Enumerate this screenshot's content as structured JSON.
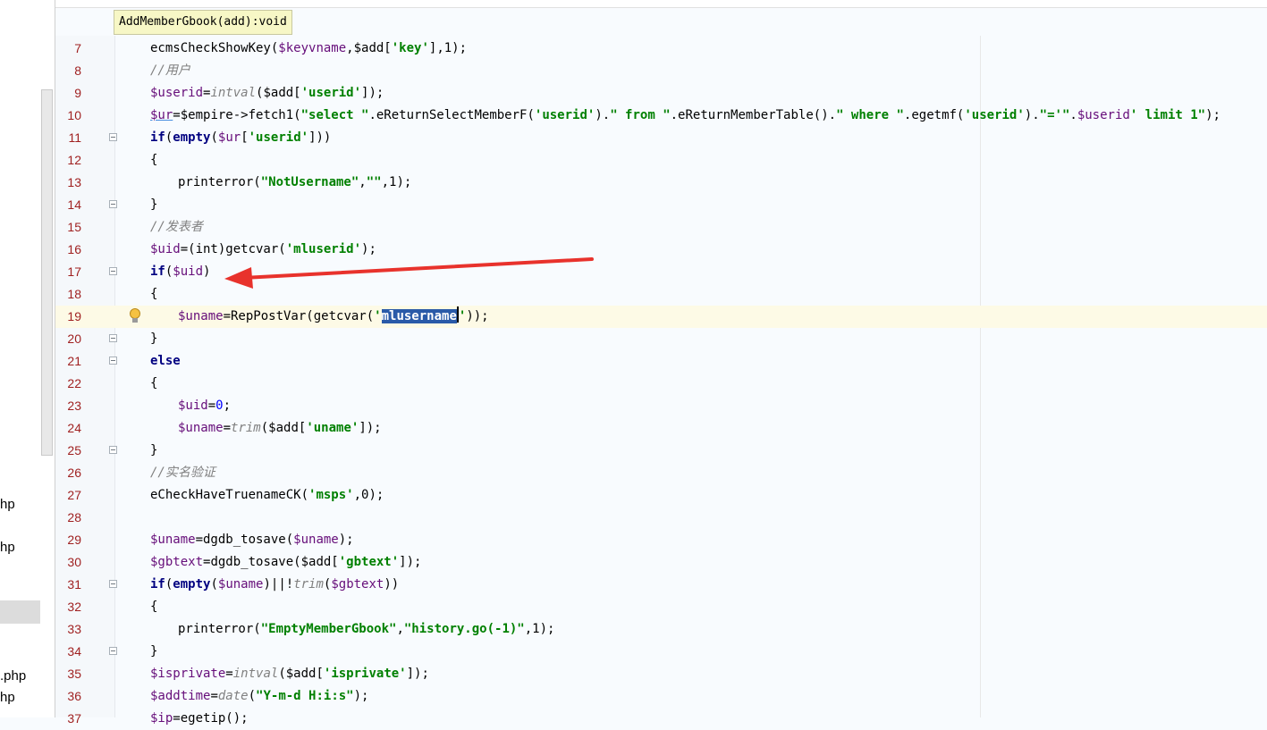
{
  "tooltip": "AddMemberGbook(add):void",
  "left_panel": {
    "files": [
      "hp",
      "hp",
      ".php",
      "hp"
    ]
  },
  "editor": {
    "current_line": 19,
    "lines": [
      {
        "n": "7",
        "fold": false,
        "indent": 1,
        "tokens": [
          [
            "fn",
            "ecmsCheckShowKey("
          ],
          [
            "var",
            "$keyvname"
          ],
          [
            "fn",
            ",$add["
          ],
          [
            "str",
            "'key'"
          ],
          [
            "fn",
            "],1);"
          ]
        ]
      },
      {
        "n": "8",
        "fold": false,
        "indent": 1,
        "tokens": [
          [
            "cmt",
            "//用户"
          ]
        ]
      },
      {
        "n": "9",
        "fold": false,
        "indent": 1,
        "tokens": [
          [
            "var",
            "$userid"
          ],
          [
            "fn",
            "="
          ],
          [
            "cmt",
            "intval"
          ],
          [
            "fn",
            "($add["
          ],
          [
            "str",
            "'userid'"
          ],
          [
            "fn",
            "]);"
          ]
        ]
      },
      {
        "n": "10",
        "fold": false,
        "indent": 1,
        "tokens": [
          [
            "var-u",
            "$ur"
          ],
          [
            "fn",
            "=$empire->fetch1("
          ],
          [
            "str",
            "\"select \""
          ],
          [
            "fn",
            ".eReturnSelectMemberF("
          ],
          [
            "str",
            "'userid'"
          ],
          [
            "fn",
            ")."
          ],
          [
            "str",
            "\" from \""
          ],
          [
            "fn",
            ".eReturnMemberTable()."
          ],
          [
            "str",
            "\" where \""
          ],
          [
            "fn",
            ".egetmf("
          ],
          [
            "str",
            "'userid'"
          ],
          [
            "fn",
            ")."
          ],
          [
            "str",
            "\"='\""
          ],
          [
            "fn",
            "."
          ],
          [
            "var",
            "$userid"
          ],
          [
            "str",
            "' limit 1\""
          ],
          [
            "fn",
            ");"
          ]
        ]
      },
      {
        "n": "11",
        "fold": true,
        "indent": 1,
        "tokens": [
          [
            "kw",
            "if"
          ],
          [
            "fn",
            "("
          ],
          [
            "kw",
            "empty"
          ],
          [
            "fn",
            "("
          ],
          [
            "var",
            "$ur"
          ],
          [
            "fn",
            "["
          ],
          [
            "str",
            "'userid'"
          ],
          [
            "fn",
            "]))"
          ]
        ]
      },
      {
        "n": "12",
        "fold": false,
        "indent": 1,
        "tokens": [
          [
            "fn",
            "{"
          ]
        ]
      },
      {
        "n": "13",
        "fold": false,
        "indent": 2,
        "tokens": [
          [
            "fn",
            "printerror("
          ],
          [
            "str",
            "\"NotUsername\""
          ],
          [
            "fn",
            ","
          ],
          [
            "str",
            "\"\""
          ],
          [
            "fn",
            ",1);"
          ]
        ]
      },
      {
        "n": "14",
        "fold": true,
        "indent": 1,
        "tokens": [
          [
            "fn",
            "}"
          ]
        ]
      },
      {
        "n": "15",
        "fold": false,
        "indent": 1,
        "tokens": [
          [
            "cmt",
            "//发表者"
          ]
        ]
      },
      {
        "n": "16",
        "fold": false,
        "indent": 1,
        "tokens": [
          [
            "var",
            "$uid"
          ],
          [
            "fn",
            "=(int)getcvar("
          ],
          [
            "str",
            "'mluserid'"
          ],
          [
            "fn",
            ");"
          ]
        ]
      },
      {
        "n": "17",
        "fold": true,
        "indent": 1,
        "tokens": [
          [
            "kw",
            "if"
          ],
          [
            "fn",
            "("
          ],
          [
            "var",
            "$uid"
          ],
          [
            "fn",
            ")"
          ]
        ]
      },
      {
        "n": "18",
        "fold": false,
        "indent": 1,
        "tokens": [
          [
            "fn",
            "{"
          ]
        ]
      },
      {
        "n": "19",
        "fold": false,
        "indent": 2,
        "bulb": true,
        "tokens": [
          [
            "var",
            "$uname"
          ],
          [
            "fn",
            "=RepPostVar(getcvar("
          ],
          [
            "str",
            "'"
          ],
          [
            "sel",
            "mlusername"
          ],
          [
            "caret",
            ""
          ],
          [
            "str",
            "'"
          ],
          [
            "fn",
            "));"
          ]
        ]
      },
      {
        "n": "20",
        "fold": true,
        "indent": 1,
        "tokens": [
          [
            "fn",
            "}"
          ]
        ]
      },
      {
        "n": "21",
        "fold": true,
        "indent": 1,
        "tokens": [
          [
            "kw",
            "else"
          ]
        ]
      },
      {
        "n": "22",
        "fold": false,
        "indent": 1,
        "tokens": [
          [
            "fn",
            "{"
          ]
        ]
      },
      {
        "n": "23",
        "fold": false,
        "indent": 2,
        "tokens": [
          [
            "var",
            "$uid"
          ],
          [
            "fn",
            "="
          ],
          [
            "num",
            "0"
          ],
          [
            "fn",
            ";"
          ]
        ]
      },
      {
        "n": "24",
        "fold": false,
        "indent": 2,
        "tokens": [
          [
            "var",
            "$uname"
          ],
          [
            "fn",
            "="
          ],
          [
            "cmt",
            "trim"
          ],
          [
            "fn",
            "($add["
          ],
          [
            "str",
            "'uname'"
          ],
          [
            "fn",
            "]);"
          ]
        ]
      },
      {
        "n": "25",
        "fold": true,
        "indent": 1,
        "tokens": [
          [
            "fn",
            "}"
          ]
        ]
      },
      {
        "n": "26",
        "fold": false,
        "indent": 1,
        "tokens": [
          [
            "cmt",
            "//实名验证"
          ]
        ]
      },
      {
        "n": "27",
        "fold": false,
        "indent": 1,
        "tokens": [
          [
            "fn",
            "eCheckHaveTruenameCK("
          ],
          [
            "str",
            "'msps'"
          ],
          [
            "fn",
            ",0);"
          ]
        ]
      },
      {
        "n": "28",
        "fold": false,
        "indent": 1,
        "tokens": []
      },
      {
        "n": "29",
        "fold": false,
        "indent": 1,
        "tokens": [
          [
            "var",
            "$uname"
          ],
          [
            "fn",
            "=dgdb_tosave("
          ],
          [
            "var",
            "$uname"
          ],
          [
            "fn",
            ");"
          ]
        ]
      },
      {
        "n": "30",
        "fold": false,
        "indent": 1,
        "tokens": [
          [
            "var",
            "$gbtext"
          ],
          [
            "fn",
            "=dgdb_tosave($add["
          ],
          [
            "str",
            "'gbtext'"
          ],
          [
            "fn",
            "]);"
          ]
        ]
      },
      {
        "n": "31",
        "fold": true,
        "indent": 1,
        "tokens": [
          [
            "kw",
            "if"
          ],
          [
            "fn",
            "("
          ],
          [
            "kw",
            "empty"
          ],
          [
            "fn",
            "("
          ],
          [
            "var",
            "$uname"
          ],
          [
            "fn",
            ")||!"
          ],
          [
            "cmt",
            "trim"
          ],
          [
            "fn",
            "("
          ],
          [
            "var",
            "$gbtext"
          ],
          [
            "fn",
            "))"
          ]
        ]
      },
      {
        "n": "32",
        "fold": false,
        "indent": 1,
        "tokens": [
          [
            "fn",
            "{"
          ]
        ]
      },
      {
        "n": "33",
        "fold": false,
        "indent": 2,
        "tokens": [
          [
            "fn",
            "printerror("
          ],
          [
            "str",
            "\"EmptyMemberGbook\""
          ],
          [
            "fn",
            ","
          ],
          [
            "str",
            "\"history.go(-1)\""
          ],
          [
            "fn",
            ",1);"
          ]
        ]
      },
      {
        "n": "34",
        "fold": true,
        "indent": 1,
        "tokens": [
          [
            "fn",
            "}"
          ]
        ]
      },
      {
        "n": "35",
        "fold": false,
        "indent": 1,
        "tokens": [
          [
            "var",
            "$isprivate"
          ],
          [
            "fn",
            "="
          ],
          [
            "cmt",
            "intval"
          ],
          [
            "fn",
            "($add["
          ],
          [
            "str",
            "'isprivate'"
          ],
          [
            "fn",
            "]);"
          ]
        ]
      },
      {
        "n": "36",
        "fold": false,
        "indent": 1,
        "tokens": [
          [
            "var",
            "$addtime"
          ],
          [
            "fn",
            "="
          ],
          [
            "cmt",
            "date"
          ],
          [
            "fn",
            "("
          ],
          [
            "str",
            "\"Y-m-d H:i:s\""
          ],
          [
            "fn",
            ");"
          ]
        ]
      },
      {
        "n": "37",
        "fold": false,
        "indent": 1,
        "tokens": [
          [
            "var",
            "$ip"
          ],
          [
            "fn",
            "=egetip();"
          ]
        ]
      }
    ]
  },
  "annotation": {
    "color": "#e8322c",
    "target": "if($uid)"
  }
}
